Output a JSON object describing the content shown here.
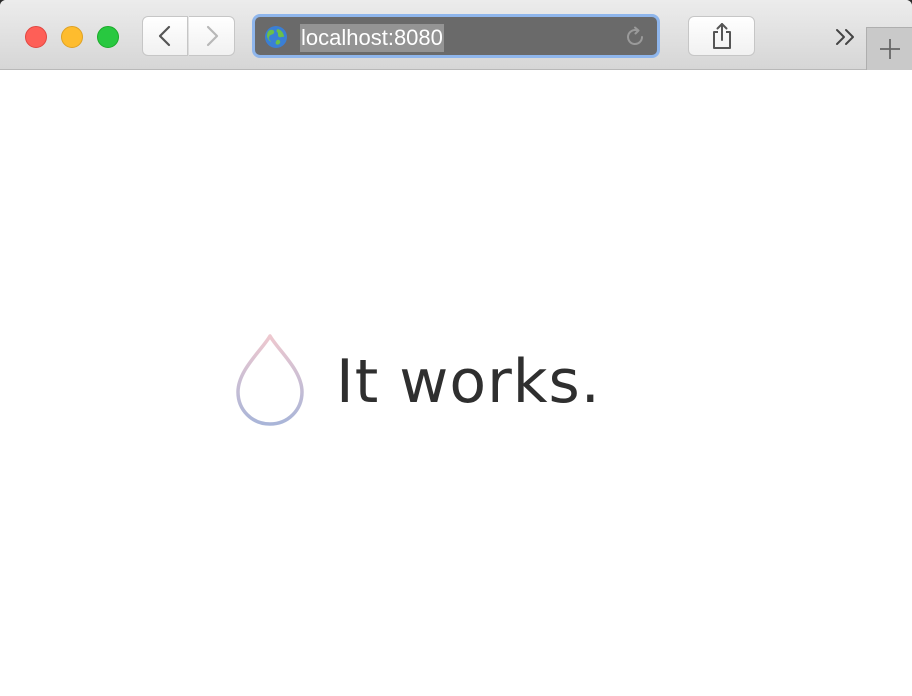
{
  "browser": {
    "address_bar": {
      "url": "localhost:8080",
      "icon": "globe-icon",
      "reload_icon": "reload-icon"
    },
    "nav": {
      "back_icon": "chevron-left-icon",
      "forward_icon": "chevron-right-icon"
    },
    "toolbar": {
      "share_icon": "share-icon",
      "more_icon": "double-chevron-right-icon",
      "new_tab_icon": "plus-icon"
    },
    "traffic_lights": {
      "close_color": "#fe5f57",
      "minimize_color": "#febc2e",
      "maximize_color": "#28c840"
    }
  },
  "page": {
    "headline": "It works.",
    "logo_icon": "drop-icon",
    "logo_gradient": [
      "#eec8cf",
      "#a9b5d8"
    ]
  }
}
